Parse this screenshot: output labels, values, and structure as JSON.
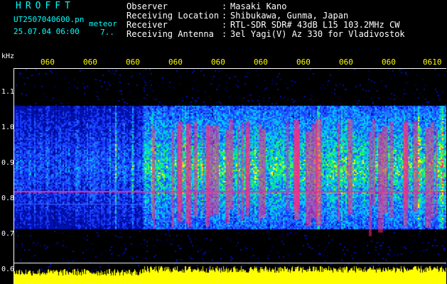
{
  "header": {
    "brand": "HROFFT",
    "filename": "UT2507040600.pn",
    "mode": "meteor",
    "datetime": "25.07.04 06:00",
    "code": "7..",
    "observer_label": "Observer",
    "observer_value": "Masaki Kano",
    "location_label": "Receiving Location",
    "location_value": "Shibukawa, Gunma, Japan",
    "receiver_label": "Receiver",
    "receiver_value": "RTL-SDR SDR# 43dB L15 103.2MHz CW",
    "antenna_label": "Receiving Antenna",
    "antenna_value": "3el Yagi(V) Az 330 for Vladivostok",
    "separator": ":"
  },
  "axes": {
    "y_unit": "kHz",
    "y_ticks": [
      "1.1",
      "1.0",
      "0.9",
      "0.8",
      "0.7",
      "0.6"
    ],
    "x_ticks": [
      "060",
      "060",
      "060",
      "060",
      "060",
      "060",
      "060",
      "060",
      "060",
      "0610"
    ]
  },
  "colors": {
    "background": "#000000",
    "header_cyan": "#00ffff",
    "info_white": "#ffffff",
    "time_yellow": "#ffff00",
    "echo_magenta": "#ff2a80",
    "noise_blue": "#1a3cff"
  }
}
